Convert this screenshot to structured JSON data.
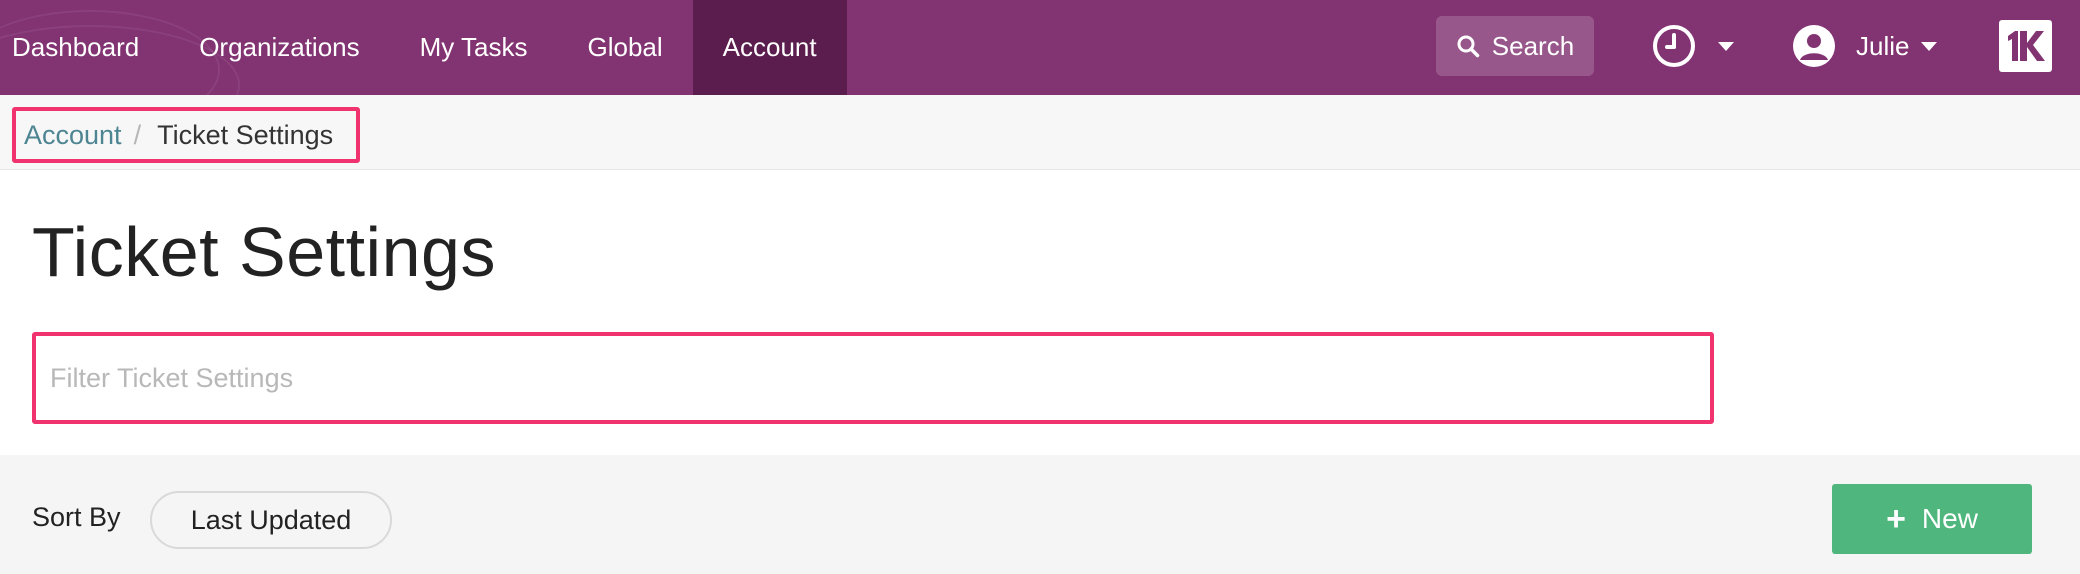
{
  "nav": {
    "items": [
      {
        "label": "Dashboard"
      },
      {
        "label": "Organizations"
      },
      {
        "label": "My Tasks"
      },
      {
        "label": "Global"
      },
      {
        "label": "Account",
        "active": true
      }
    ],
    "search_label": "Search",
    "user_name": "Julie",
    "icons": [
      "search-icon",
      "clock-icon",
      "user-avatar-icon",
      "chevron-down-icon",
      "1k-logo-icon"
    ]
  },
  "breadcrumb": {
    "parent": "Account",
    "separator": "/",
    "current": "Ticket Settings"
  },
  "page": {
    "title": "Ticket Settings",
    "filter_placeholder": "Filter Ticket Settings",
    "filter_value": ""
  },
  "sort": {
    "label": "Sort By",
    "selected": "Last Updated"
  },
  "actions": {
    "new_label": "New"
  },
  "colors": {
    "topbar": "#823372",
    "active_nav": "#5b1d4e",
    "highlight": "#f0336e",
    "primary_button": "#4fb77d",
    "link": "#4e8592"
  }
}
